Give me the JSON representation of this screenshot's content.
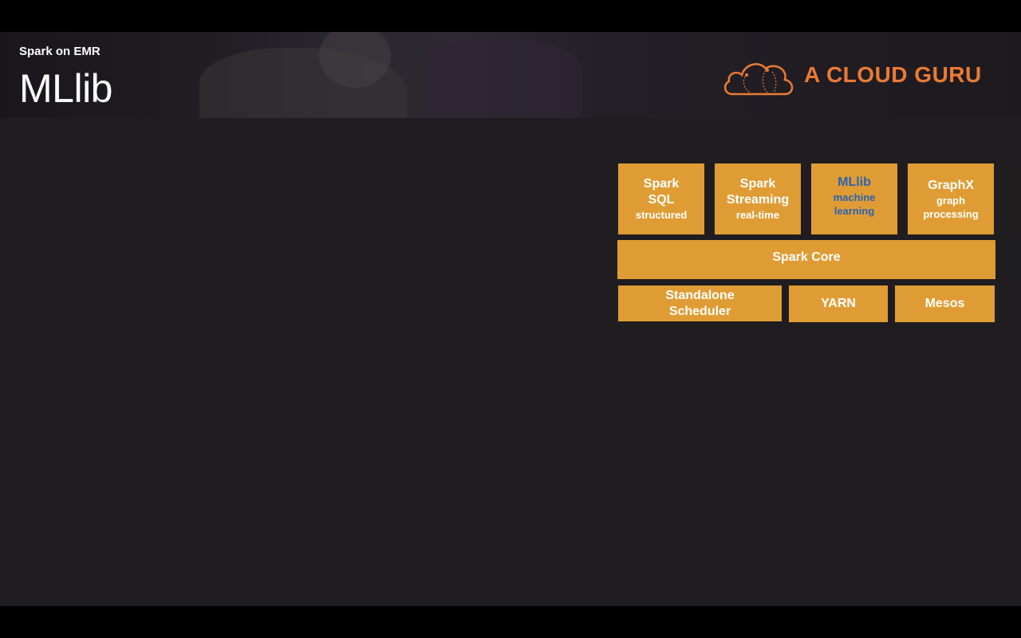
{
  "header": {
    "subtitle": "Spark on EMR",
    "title": "MLlib",
    "logo_text": "A CLOUD GURU",
    "logo_icon": "cloud-icon",
    "accent_color": "#ea7b34"
  },
  "diagram": {
    "block_color": "#e09c34",
    "highlight_color": "#2a64b0",
    "libraries": [
      {
        "main_lines": [
          "Spark",
          "SQL"
        ],
        "sub": "structured"
      },
      {
        "main_lines": [
          "Spark",
          "Streaming"
        ],
        "sub": "real-time"
      },
      {
        "main_lines": [
          "MLlib"
        ],
        "sub_lines": [
          "machine",
          "learning"
        ]
      },
      {
        "main_lines": [
          "GraphX"
        ],
        "sub_lines": [
          "graph",
          "processing"
        ]
      }
    ],
    "core": "Spark Core",
    "schedulers": [
      {
        "lines": [
          "Standalone",
          "Scheduler"
        ]
      },
      {
        "lines": [
          "YARN"
        ]
      },
      {
        "lines": [
          "Mesos"
        ]
      }
    ]
  }
}
